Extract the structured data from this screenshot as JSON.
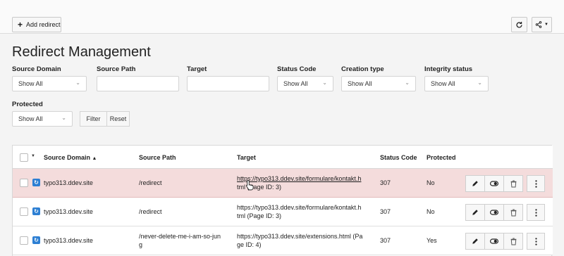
{
  "toolbar": {
    "add_label": "Add redirect",
    "icons": {
      "add": "plus-icon",
      "refresh": "refresh-icon",
      "share": "share-icon",
      "share_caret": "caret-down-icon"
    }
  },
  "page_title": "Redirect Management",
  "filters": {
    "source_domain": {
      "label": "Source Domain",
      "value": "Show All"
    },
    "source_path": {
      "label": "Source Path",
      "value": ""
    },
    "target": {
      "label": "Target",
      "value": ""
    },
    "status_code": {
      "label": "Status Code",
      "value": "Show All"
    },
    "creation_type": {
      "label": "Creation type",
      "value": "Show All"
    },
    "integrity_status": {
      "label": "Integrity status",
      "value": "Show All"
    },
    "protected": {
      "label": "Protected",
      "value": "Show All"
    },
    "filter_button": "Filter",
    "reset_button": "Reset"
  },
  "table": {
    "columns": {
      "source_domain": "Source Domain",
      "source_path": "Source Path",
      "target": "Target",
      "status_code": "Status Code",
      "protected": "Protected"
    },
    "sort_indicator": "▲",
    "rows": [
      {
        "source_domain": "typo313.ddev.site",
        "source_path": "/redirect",
        "target_line1": "https://typo313.ddev.site/formulare/kontakt.h",
        "target_line2": "tml (Page ID: 3)",
        "status_code": "307",
        "protected": "No",
        "highlighted": true
      },
      {
        "source_domain": "typo313.ddev.site",
        "source_path": "/redirect",
        "target_line1": "https://typo313.ddev.site/formulare/kontakt.h",
        "target_line2": "tml (Page ID: 3)",
        "status_code": "307",
        "protected": "No",
        "highlighted": false
      },
      {
        "source_domain": "typo313.ddev.site",
        "source_path_line1": "/never-delete-me-i-am-so-jun",
        "source_path_line2": "g",
        "target_line1": "https://typo313.ddev.site/extensions.html (Pa",
        "target_line2": "ge ID: 4)",
        "status_code": "307",
        "protected": "Yes",
        "highlighted": false
      }
    ],
    "row_action_icons": [
      "edit-icon",
      "toggle-icon",
      "delete-icon",
      "more-icon"
    ]
  },
  "colors": {
    "highlight_row": "#f4dcdc",
    "domain_icon": "#2d7fd3",
    "background": "#f4f4f4"
  }
}
